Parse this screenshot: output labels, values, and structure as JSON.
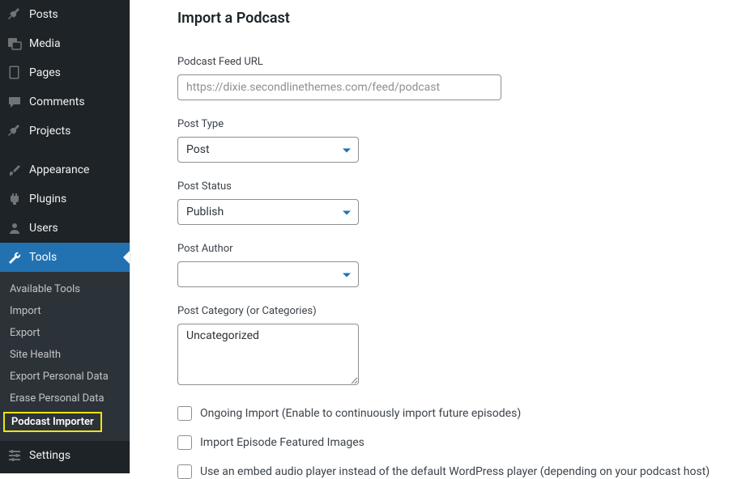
{
  "sidebar": {
    "posts": "Posts",
    "media": "Media",
    "pages": "Pages",
    "comments": "Comments",
    "projects": "Projects",
    "appearance": "Appearance",
    "plugins": "Plugins",
    "users": "Users",
    "tools": "Tools",
    "settings": "Settings",
    "submenu": {
      "available_tools": "Available Tools",
      "import": "Import",
      "export": "Export",
      "site_health": "Site Health",
      "export_personal": "Export Personal Data",
      "erase_personal": "Erase Personal Data",
      "podcast_importer": "Podcast Importer"
    }
  },
  "page": {
    "title": "Import a Podcast"
  },
  "form": {
    "feed_url_label": "Podcast Feed URL",
    "feed_url_placeholder": "https://dixie.secondlinethemes.com/feed/podcast",
    "post_type_label": "Post Type",
    "post_type_value": "Post",
    "post_status_label": "Post Status",
    "post_status_value": "Publish",
    "post_author_label": "Post Author",
    "post_author_value": "",
    "post_category_label": "Post Category (or Categories)",
    "post_category_value": "Uncategorized",
    "ongoing_import_label": "Ongoing Import (Enable to continuously import future episodes)",
    "import_featured_label": "Import Episode Featured Images",
    "embed_player_label": "Use an embed audio player instead of the default WordPress player (depending on your podcast host)"
  }
}
